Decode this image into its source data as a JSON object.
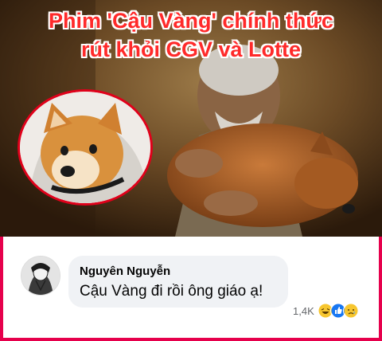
{
  "headline": {
    "line1": "Phim 'Cậu Vàng' chính thức",
    "line2": "rút khỏi CGV và Lotte"
  },
  "comment": {
    "author": "Nguyên Nguyễn",
    "text": "Cậu Vàng đi rồi ông giáo ạ!",
    "reaction_count": "1,4K",
    "reactions": [
      "haha-icon",
      "like-icon",
      "sad-icon"
    ]
  },
  "colors": {
    "frame": "#e6004c",
    "headline": "#ff2a2a",
    "bubble": "#f0f2f5"
  }
}
